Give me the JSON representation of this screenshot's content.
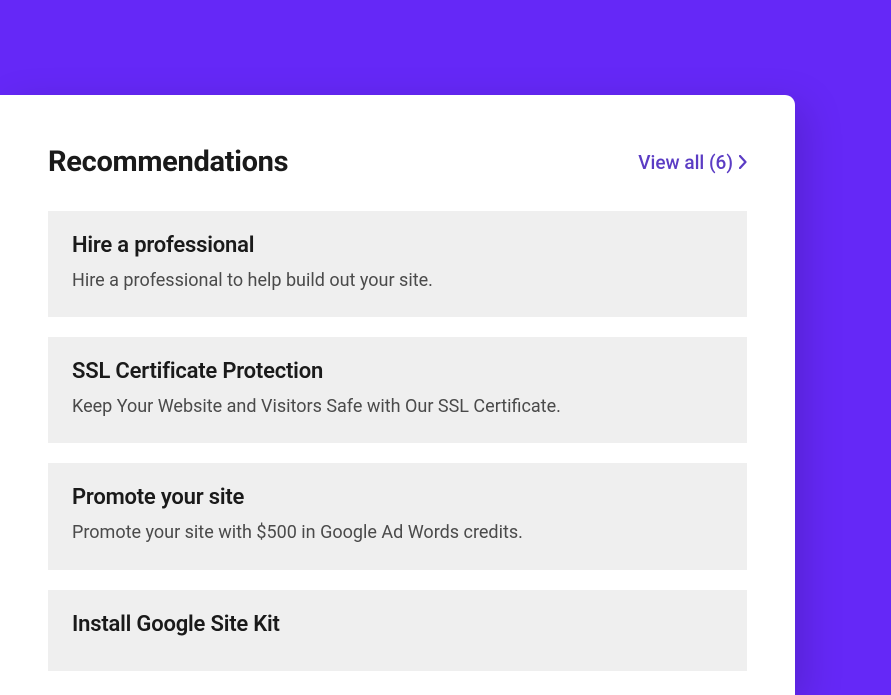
{
  "header": {
    "title": "Recommendations",
    "view_all_label": "View all (6)"
  },
  "recommendations": [
    {
      "title": "Hire a professional",
      "description": "Hire a professional to help build out your site."
    },
    {
      "title": "SSL Certificate Protection",
      "description": "Keep Your Website and Visitors Safe with Our SSL Certificate."
    },
    {
      "title": "Promote your site",
      "description": "Promote your site with $500 in Google Ad Words credits."
    },
    {
      "title": "Install Google Site Kit",
      "description": ""
    }
  ],
  "colors": {
    "background": "#6528F7",
    "link": "#5B3CC4",
    "card_bg": "#efefef"
  }
}
